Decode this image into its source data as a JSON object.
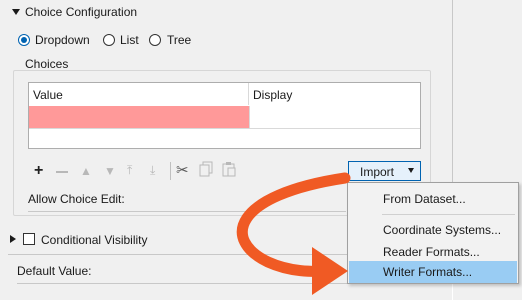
{
  "choice_config": {
    "title": "Choice Configuration",
    "radio_options": [
      {
        "label": "Dropdown",
        "selected": true
      },
      {
        "label": "List",
        "selected": false
      },
      {
        "label": "Tree",
        "selected": false
      }
    ],
    "choices_label": "Choices",
    "table": {
      "columns": [
        "Value",
        "Display"
      ],
      "rows": [
        {
          "value": "",
          "display": "",
          "invalid": true
        }
      ]
    },
    "toolbar_icons": [
      "plus-icon",
      "minus-icon",
      "move-up-icon",
      "move-down-icon",
      "move-top-icon",
      "move-bottom-icon",
      "cut-icon",
      "copy-icon",
      "paste-icon"
    ],
    "import_label": "Import",
    "allow_choice_edit_label": "Allow Choice Edit:"
  },
  "conditional_visibility": {
    "label": "Conditional Visibility",
    "checked": false
  },
  "default_value": {
    "label": "Default Value:"
  },
  "import_menu": {
    "items": [
      "From Dataset...",
      "Coordinate Systems...",
      "Reader Formats...",
      "Writer Formats..."
    ],
    "highlighted": "Writer Formats..."
  },
  "colors": {
    "invalid_cell": "#ff9999",
    "selection": "#99ccf3",
    "accent": "#0063b1",
    "arrow": "#f05a24"
  }
}
